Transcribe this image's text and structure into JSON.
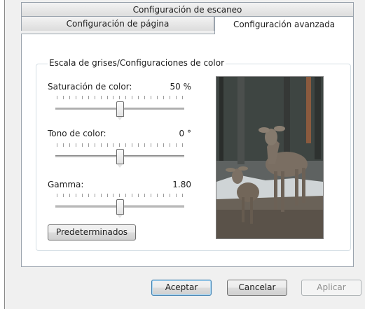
{
  "tabs": {
    "scan_settings": "Configuración de escaneo",
    "page_settings": "Configuración de página",
    "advanced_settings": "Configuración avanzada"
  },
  "group": {
    "title": "Escala de grises/Configuraciones de color"
  },
  "sliders": [
    {
      "label": "Saturación de color:",
      "value_text": "50 %",
      "level": 0.5
    },
    {
      "label": "Tono de color:",
      "value_text": "0 °",
      "level": 0.5
    },
    {
      "label": "Gamma:",
      "value_text": "1.80",
      "level": 0.5
    }
  ],
  "buttons": {
    "defaults": "Predeterminados",
    "accept": "Aceptar",
    "cancel": "Cancelar",
    "apply": "Aplicar"
  },
  "preview": {
    "description_icon": "deer-preview-image"
  },
  "colors": {
    "accent": "#3c7fb1",
    "tab_border": "#9aa3ad",
    "dialog_bg": "#f0f0f0"
  }
}
